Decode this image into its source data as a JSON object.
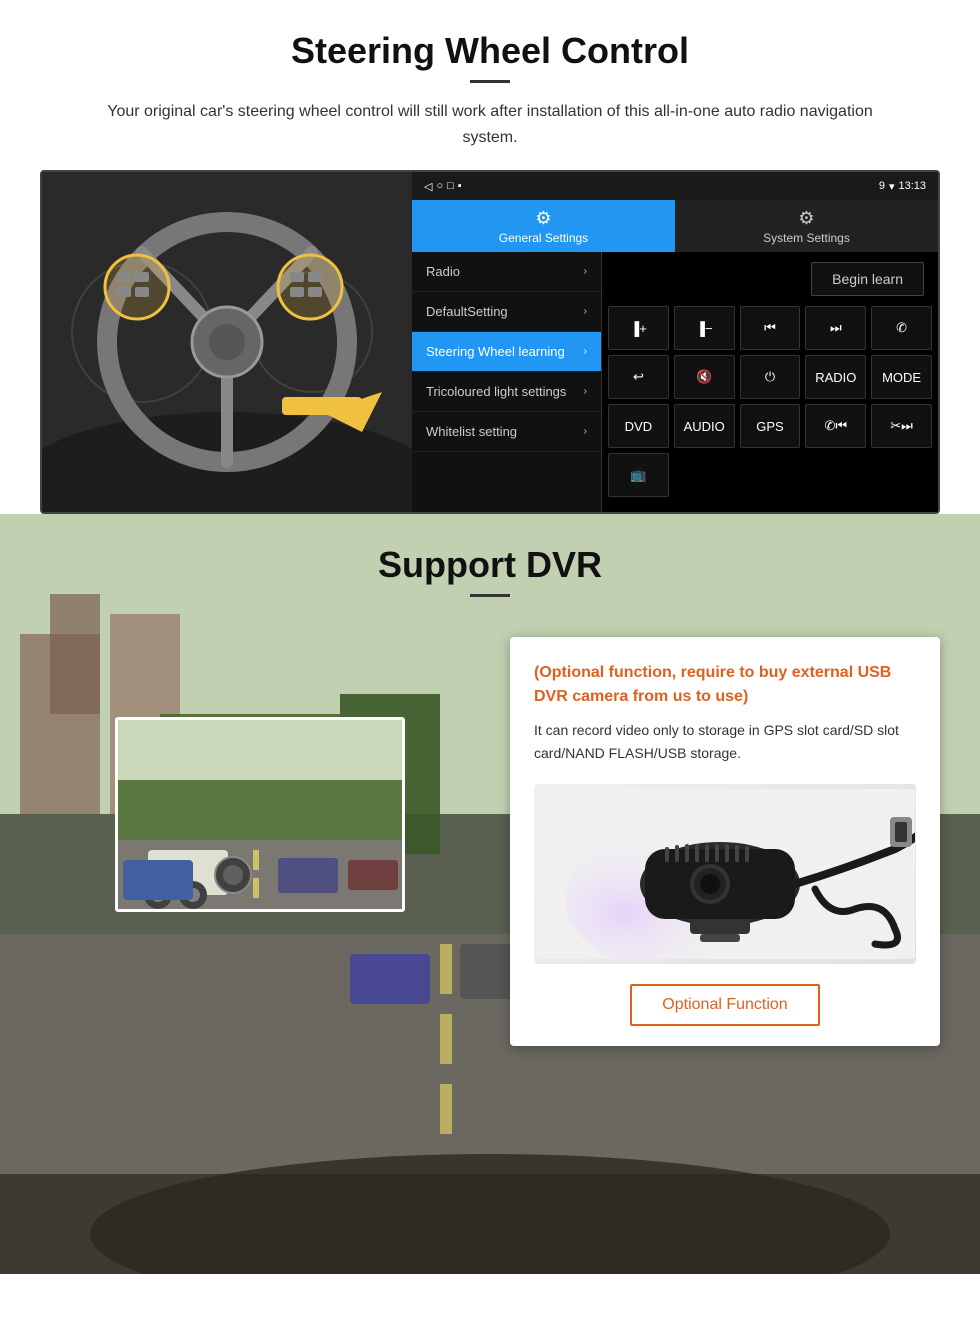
{
  "section1": {
    "title": "Steering Wheel Control",
    "subtitle": "Your original car's steering wheel control will still work after installation of this all-in-one auto radio navigation system.",
    "android": {
      "statusbar": {
        "time": "13:13",
        "icons": "9 ▾"
      },
      "navbar": {
        "back": "◁",
        "home": "○",
        "recent": "□",
        "menu": "▪"
      },
      "tabs": {
        "general": {
          "label": "General Settings",
          "icon": "⚙"
        },
        "system": {
          "label": "System Settings",
          "icon": "⚙"
        }
      },
      "menu_items": [
        {
          "label": "Radio",
          "active": false
        },
        {
          "label": "DefaultSetting",
          "active": false
        },
        {
          "label": "Steering Wheel learning",
          "active": true
        },
        {
          "label": "Tricoloured light settings",
          "active": false
        },
        {
          "label": "Whitelist setting",
          "active": false
        }
      ],
      "begin_learn": "Begin learn",
      "control_buttons": [
        "▐+",
        "▐-",
        "◀◀",
        "▶▶",
        "☎",
        "↩",
        "🔇x",
        "⏻",
        "RADIO",
        "MODE",
        "DVD",
        "AUDIO",
        "GPS",
        "📞◀◀",
        "✂▶▶",
        "📺"
      ]
    }
  },
  "section2": {
    "title": "Support DVR",
    "optional_title": "(Optional function, require to buy external USB DVR camera from us to use)",
    "description": "It can record video only to storage in GPS slot card/SD slot card/NAND FLASH/USB storage.",
    "optional_button": "Optional Function"
  }
}
